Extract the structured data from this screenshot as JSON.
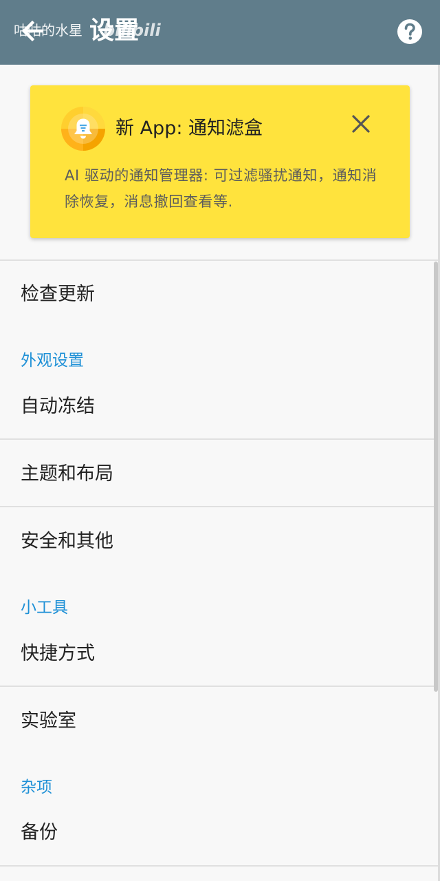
{
  "appbar": {
    "title": "设置",
    "watermark": "咕咕的水星",
    "watermark_logo": "bilibili",
    "back_icon": "back-arrow-icon",
    "help_icon": "help-icon",
    "color": "#607d8b"
  },
  "promo": {
    "title": "新 App: 通知滤盒",
    "description": "AI 驱动的通知管理器: 可过滤骚扰通知，通知消除恢复，消息撤回查看等.",
    "icon": "bell-icon",
    "close_icon": "close-icon",
    "background": "#ffe33d"
  },
  "menu": {
    "check_update": "检查更新",
    "appearance_header": "外观设置",
    "auto_freeze": "自动冻结",
    "theme_layout": "主题和布局",
    "security_other": "安全和其他",
    "tools_header": "小工具",
    "shortcuts": "快捷方式",
    "lab": "实验室",
    "misc_header": "杂项",
    "backup": "备份"
  },
  "colors": {
    "accent": "#1e90d6",
    "text": "#222222"
  }
}
